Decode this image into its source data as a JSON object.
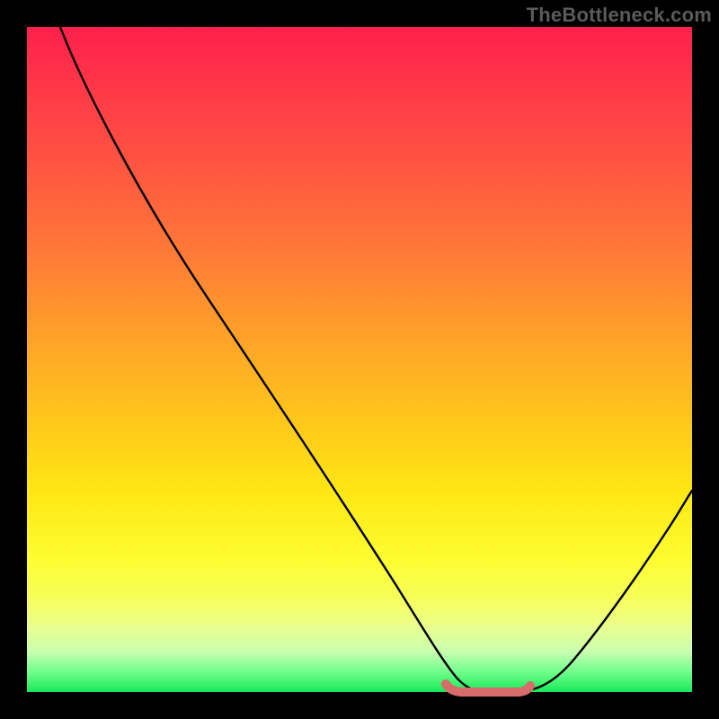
{
  "watermark": "TheBottleneck.com",
  "colors": {
    "frame_bg": "#000000",
    "curve_stroke": "#000000",
    "optimum_stroke": "#d86b6b",
    "gradient_top": "#ff1f4b",
    "gradient_bottom": "#19e858"
  },
  "chart_data": {
    "type": "line",
    "title": "",
    "xlabel": "",
    "ylabel": "",
    "xlim": [
      0,
      100
    ],
    "ylim": [
      0,
      100
    ],
    "grid": false,
    "series": [
      {
        "name": "bottleneck-curve",
        "x": [
          5,
          10,
          15,
          20,
          25,
          30,
          35,
          40,
          45,
          50,
          55,
          60,
          62,
          64,
          66,
          68,
          70,
          72,
          75,
          80,
          85,
          90,
          95,
          100
        ],
        "y": [
          100,
          93,
          86,
          78,
          70,
          62,
          54,
          46,
          37,
          28,
          19,
          10,
          6,
          3,
          1,
          0,
          0,
          0,
          1,
          4,
          10,
          18,
          28,
          40
        ]
      }
    ],
    "annotations": [
      {
        "name": "optimum-flat-segment",
        "x_start": 62,
        "x_end": 75,
        "y": 0
      }
    ]
  }
}
